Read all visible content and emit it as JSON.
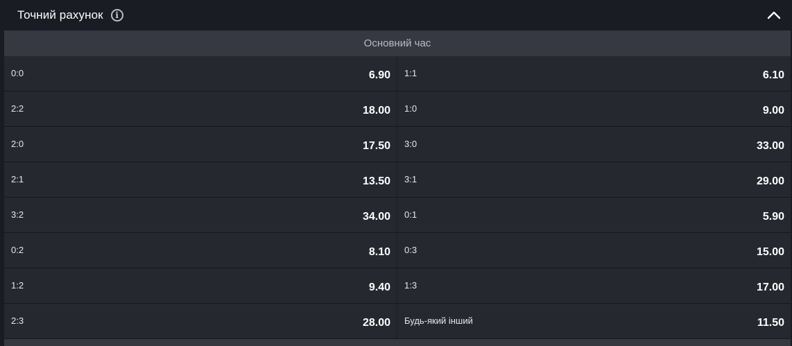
{
  "header": {
    "title": "Точний рахунок",
    "info_icon": "info-icon",
    "collapse_icon": "chevron-up-icon"
  },
  "subheader": {
    "label": "Основний час"
  },
  "rows": [
    {
      "left": {
        "outcome": "0:0",
        "odds": "6.90"
      },
      "right": {
        "outcome": "1:1",
        "odds": "6.10"
      }
    },
    {
      "left": {
        "outcome": "2:2",
        "odds": "18.00"
      },
      "right": {
        "outcome": "1:0",
        "odds": "9.00"
      }
    },
    {
      "left": {
        "outcome": "2:0",
        "odds": "17.50"
      },
      "right": {
        "outcome": "3:0",
        "odds": "33.00"
      }
    },
    {
      "left": {
        "outcome": "2:1",
        "odds": "13.50"
      },
      "right": {
        "outcome": "3:1",
        "odds": "29.00"
      }
    },
    {
      "left": {
        "outcome": "3:2",
        "odds": "34.00"
      },
      "right": {
        "outcome": "0:1",
        "odds": "5.90"
      }
    },
    {
      "left": {
        "outcome": "0:2",
        "odds": "8.10"
      },
      "right": {
        "outcome": "0:3",
        "odds": "15.00"
      }
    },
    {
      "left": {
        "outcome": "1:2",
        "odds": "9.40"
      },
      "right": {
        "outcome": "1:3",
        "odds": "17.00"
      }
    },
    {
      "left": {
        "outcome": "2:3",
        "odds": "28.00"
      },
      "right": {
        "outcome": "Будь-який інший",
        "odds": "11.50"
      }
    }
  ],
  "colors": {
    "background": "#1a1c24",
    "row": "#262830",
    "subheader": "#363842",
    "text": "#ffffff",
    "muted": "#b9bcc4"
  }
}
